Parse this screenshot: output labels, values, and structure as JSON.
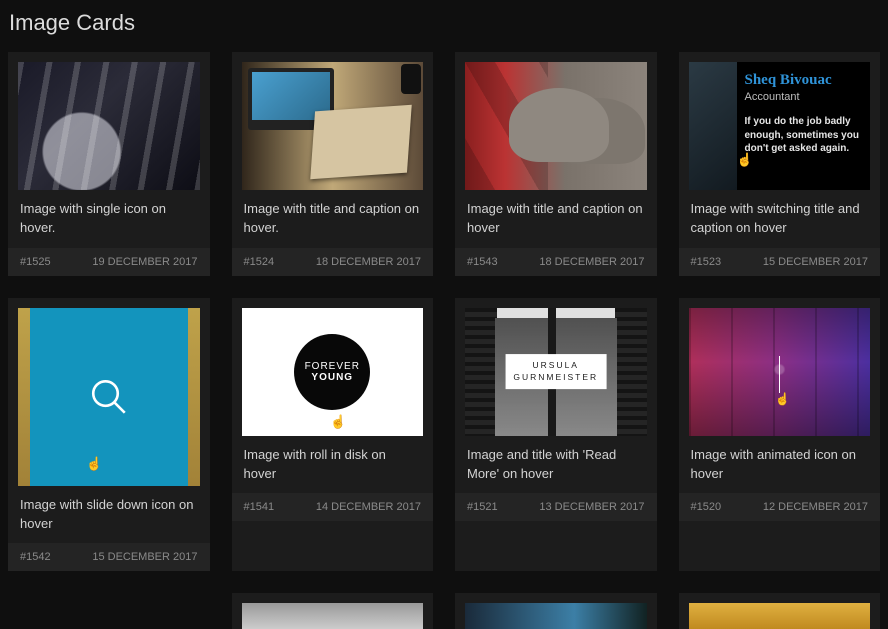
{
  "page_title": "Image Cards",
  "cards": [
    {
      "desc": "Image with single icon on hover.",
      "id": "#1525",
      "date": "19 DECEMBER 2017"
    },
    {
      "desc": "Image with title and caption on hover.",
      "id": "#1524",
      "date": "18 DECEMBER 2017"
    },
    {
      "desc": "Image with title and caption on hover",
      "id": "#1543",
      "date": "18 DECEMBER 2017"
    },
    {
      "desc": "Image with switching title and caption on hover",
      "id": "#1523",
      "date": "15 DECEMBER 2017"
    },
    {
      "desc": "Image with slide down icon on hover",
      "id": "#1542",
      "date": "15 DECEMBER 2017"
    },
    {
      "desc": "Image with roll in disk on hover",
      "id": "#1541",
      "date": "14 DECEMBER 2017"
    },
    {
      "desc": "Image and title with 'Read More' on hover",
      "id": "#1521",
      "date": "13 DECEMBER 2017"
    },
    {
      "desc": "Image with animated icon on hover",
      "id": "#1520",
      "date": "12 DECEMBER 2017"
    }
  ],
  "card4_overlay": {
    "name": "Sheq Bivouac",
    "role": "Accountant",
    "quote": "If you do the job badly enough, sometimes you don't get asked again."
  },
  "card6_overlay": {
    "line1": "FOREVER",
    "line2": "YOUNG"
  },
  "card7_overlay": {
    "line1": "URSULA",
    "line2": "GURNMEISTER"
  }
}
